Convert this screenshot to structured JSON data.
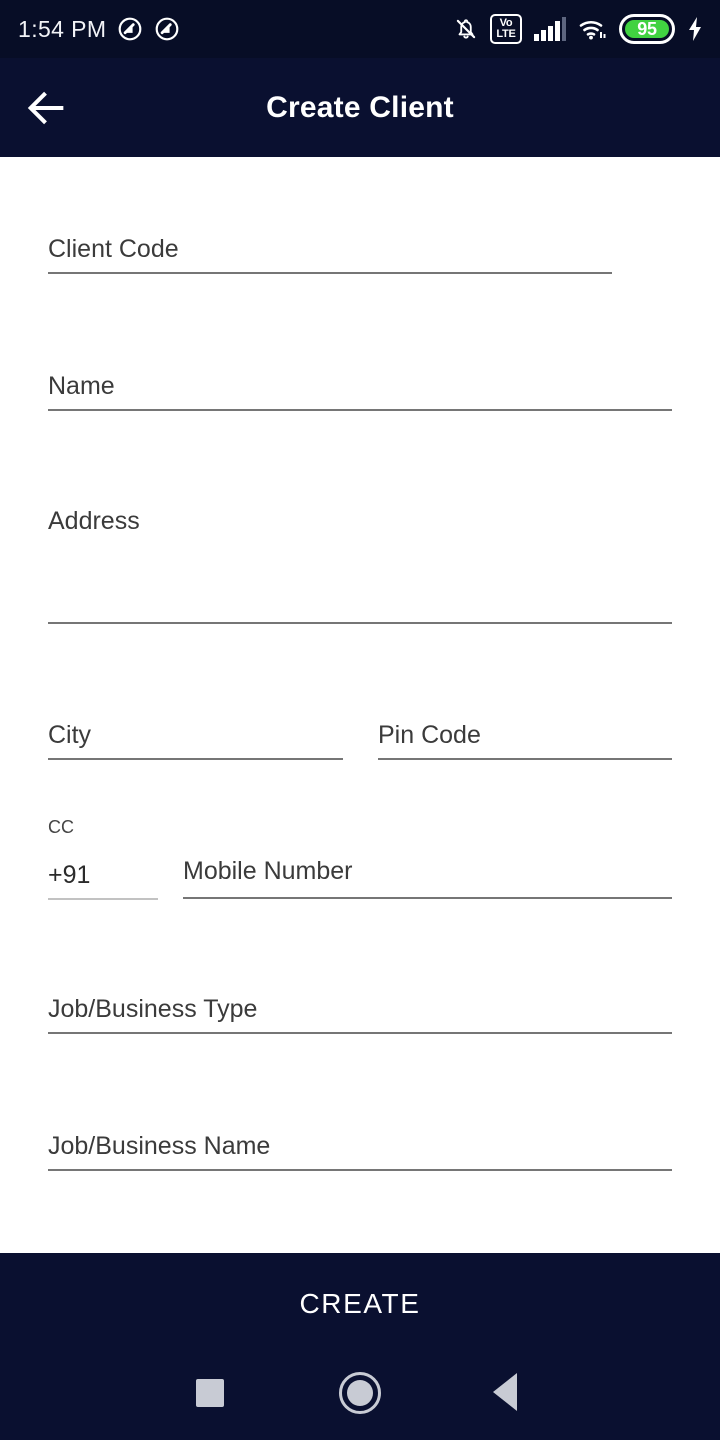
{
  "status_bar": {
    "time": "1:54 PM",
    "left_icons": [
      "dnd-circle-slash-icon",
      "dnd-circle-slash-icon"
    ],
    "right_icons": [
      "bell-muted-icon",
      "volte-icon",
      "signal-bars-icon",
      "wifi-icon",
      "battery-icon",
      "charging-bolt-icon"
    ],
    "volte_top": "Vo",
    "volte_bottom": "LTE",
    "battery_level": "95",
    "battery_color": "#41d241"
  },
  "app_bar": {
    "title": "Create Client",
    "back_icon": "arrow-left-icon",
    "background": "#0a1030"
  },
  "form": {
    "fields": [
      {
        "label": "Client Code",
        "value": "",
        "type": "text"
      },
      {
        "label": "Name",
        "value": "",
        "type": "text"
      },
      {
        "label": "Address",
        "value": "",
        "type": "textarea"
      },
      {
        "label": "City",
        "value": "",
        "type": "text"
      },
      {
        "label": "Pin Code",
        "value": "",
        "type": "text"
      },
      {
        "label": "CC",
        "value": "+91",
        "type": "text"
      },
      {
        "label": "Mobile Number",
        "value": "",
        "type": "tel"
      },
      {
        "label": "Job/Business Type",
        "value": "",
        "type": "text"
      },
      {
        "label": "Job/Business Name",
        "value": "",
        "type": "text"
      }
    ]
  },
  "footer": {
    "create_label": "CREATE",
    "background": "#0a1030"
  },
  "nav_bar": {
    "recents_icon": "square-icon",
    "home_icon": "circle-icon",
    "back_icon": "triangle-left-icon",
    "color": "#c8cbd4"
  }
}
